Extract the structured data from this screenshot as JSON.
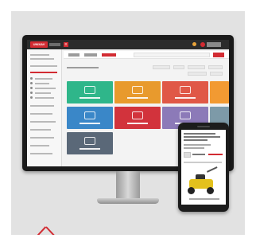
{
  "app": {
    "logo_text": "UNIXAV"
  },
  "colors": {
    "brand_red": "#d22b32",
    "tiles": [
      "#2fb68a",
      "#e89a2d",
      "#e05847",
      "#f29a32",
      "#3a87c8",
      "#d2333c",
      "#8c7ab8",
      "#7d9aa8",
      "#5a6878"
    ]
  },
  "icons": [
    "menu-icon",
    "bell-icon",
    "user-avatar-icon",
    "search-icon"
  ]
}
